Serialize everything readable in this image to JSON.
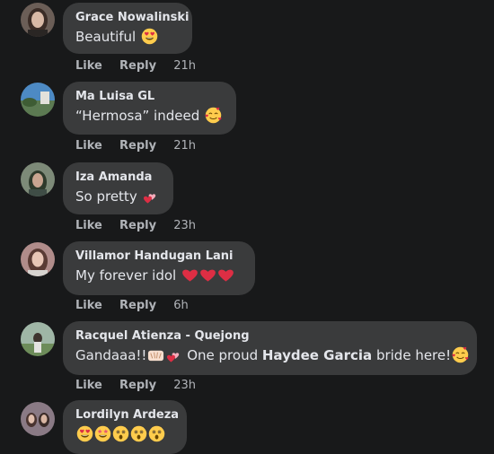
{
  "comments": [
    {
      "name": "Grace Nowalinski",
      "text": "Beautiful",
      "emojis": [
        "heart-eyes-emoji"
      ],
      "like": "Like",
      "reply": "Reply",
      "time": "21h"
    },
    {
      "name": "Ma Luisa GL",
      "text": "“Hermosa” indeed",
      "emojis": [
        "smiling-face-with-hearts-emoji"
      ],
      "like": "Like",
      "reply": "Reply",
      "time": "21h"
    },
    {
      "name": "Iza Amanda",
      "text": "So pretty",
      "emojis": [
        "two-hearts-emoji"
      ],
      "like": "Like",
      "reply": "Reply",
      "time": "23h"
    },
    {
      "name": "Villamor Handugan Lani",
      "text": "My forever idol",
      "emojis": [
        "red-heart-emoji",
        "red-heart-emoji",
        "red-heart-emoji"
      ],
      "like": "Like",
      "reply": "Reply",
      "time": "6h"
    },
    {
      "name": "Racquel Atienza - Quejong",
      "text_before": "Gandaaa!!",
      "text_middle": " One proud ",
      "text_bold": "Haydee Garcia",
      "text_after": " bride here!",
      "emojis": [
        "raising-hands-emoji",
        "two-hearts-emoji",
        "smiling-face-with-hearts-emoji"
      ],
      "like": "Like",
      "reply": "Reply",
      "time": "23h"
    },
    {
      "name": "Lordilyn Ardeza",
      "text": "",
      "emojis": [
        "heart-eyes-emoji",
        "star-struck-emoji",
        "astonished-emoji",
        "astonished-emoji",
        "astonished-emoji"
      ]
    }
  ],
  "colors": {
    "background": "#18191a",
    "bubble": "#3a3b3c",
    "primary_text": "#e4e6eb",
    "secondary_text": "#b0b3b8"
  }
}
